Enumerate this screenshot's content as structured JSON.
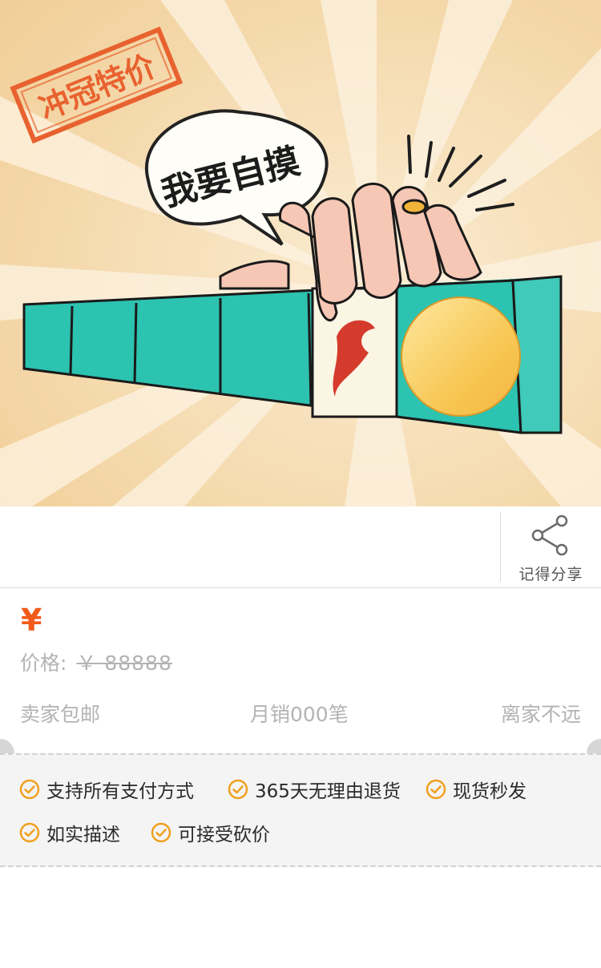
{
  "hero": {
    "stamp_text": "冲冠特价",
    "speech_text": "我要自摸"
  },
  "share": {
    "label": "记得分享",
    "icon": "share-icon"
  },
  "price": {
    "currency_symbol": "¥",
    "original_label": "价格:",
    "original_value": "￥  88888"
  },
  "meta": {
    "shipping": "卖家包邮",
    "monthly_sales": "月销000笔",
    "distance": "离家不远"
  },
  "guarantees": [
    {
      "label": "支持所有支付方式",
      "icon": "check-circle-icon"
    },
    {
      "label": "365天无理由退货",
      "icon": "check-circle-icon"
    },
    {
      "label": "现货秒发",
      "icon": "check-circle-icon"
    },
    {
      "label": "如实描述",
      "icon": "check-circle-icon"
    },
    {
      "label": "可接受砍价",
      "icon": "check-circle-icon"
    }
  ],
  "colors": {
    "accent": "#f25a1a",
    "check": "#f0a020",
    "hero_bg": "#f6dcb0",
    "tile_teal": "#2cc3b0"
  }
}
